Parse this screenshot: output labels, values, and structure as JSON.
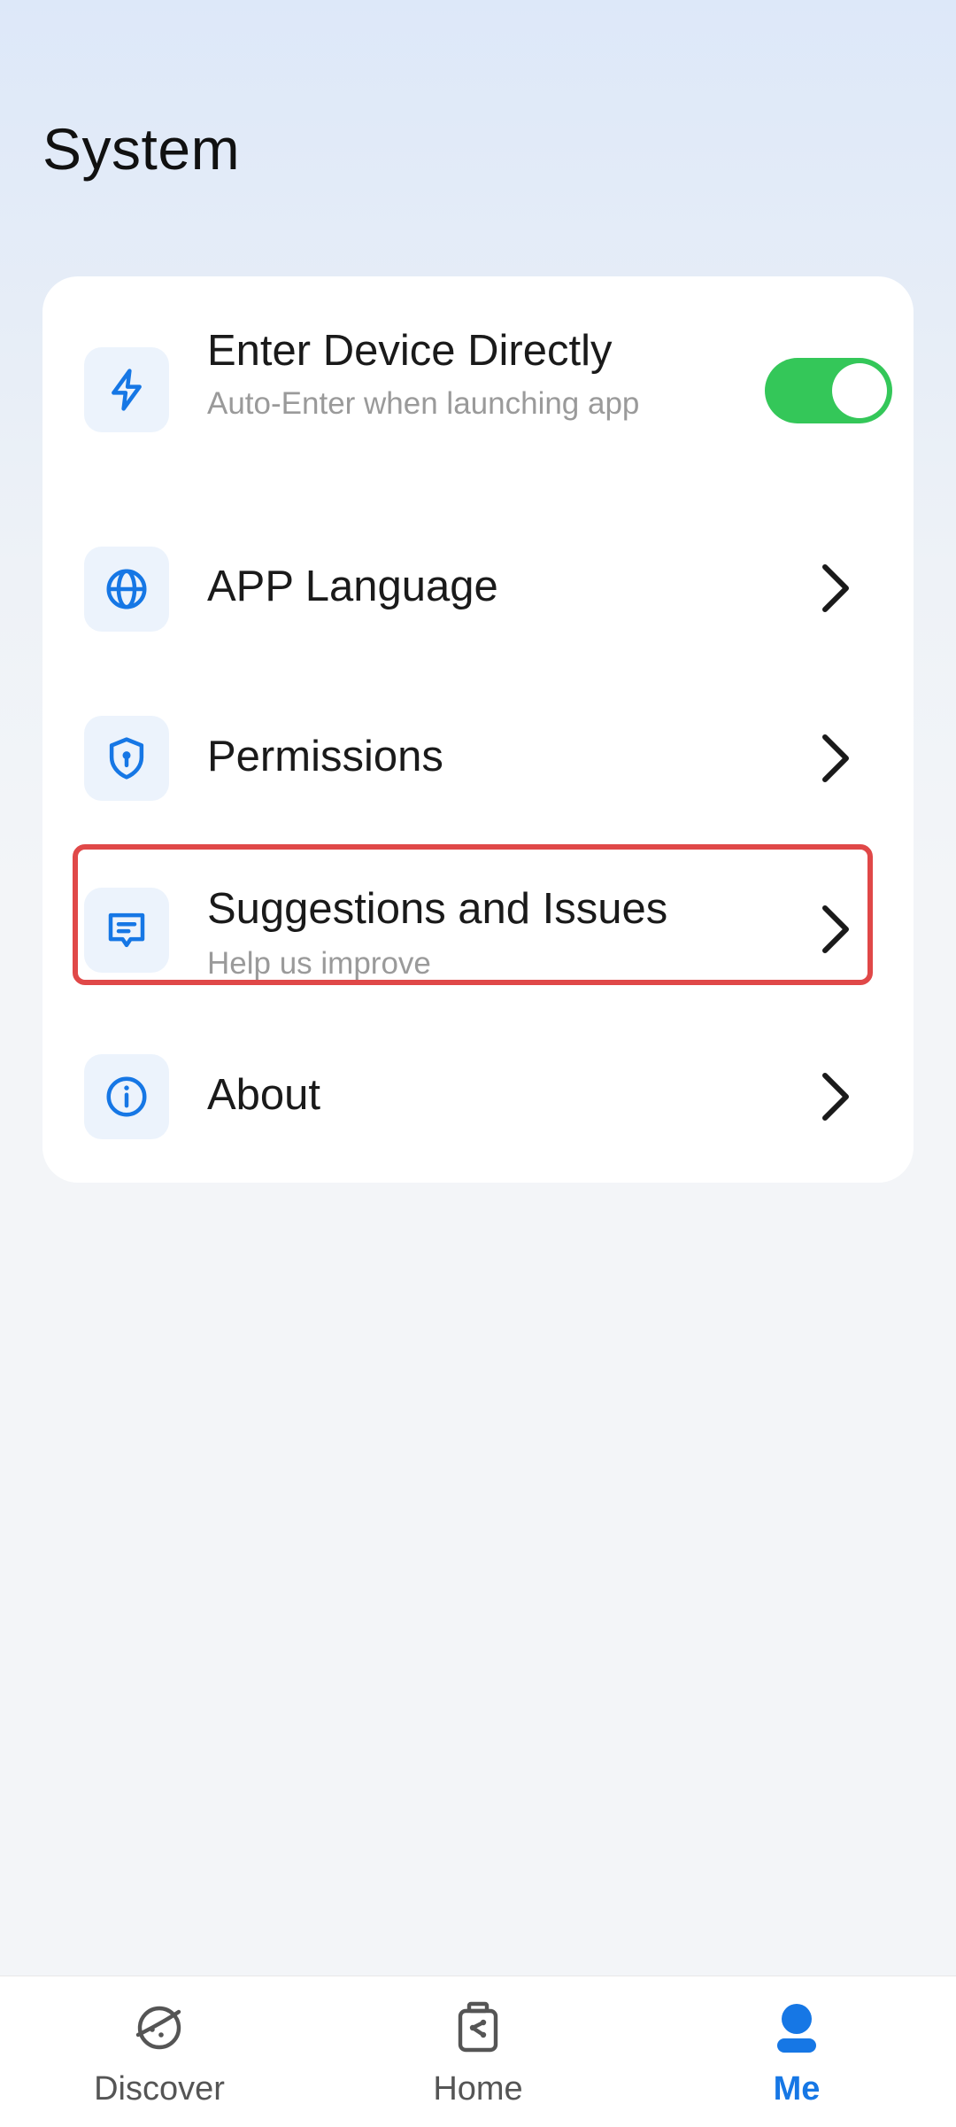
{
  "page": {
    "title": "System"
  },
  "settings": {
    "items": [
      {
        "label": "Enter Device Directly",
        "sublabel": "Auto-Enter when launching app",
        "icon": "lightning-icon",
        "toggle_on": true
      },
      {
        "label": "APP Language",
        "icon": "globe-icon"
      },
      {
        "label": "Permissions",
        "icon": "shield-icon"
      },
      {
        "label": "Suggestions and Issues",
        "sublabel": "Help us improve",
        "icon": "feedback-message-icon"
      },
      {
        "label": "About",
        "icon": "info-icon"
      }
    ]
  },
  "tabbar": {
    "tabs": [
      {
        "label": "Discover",
        "icon": "discover-planet-icon"
      },
      {
        "label": "Home",
        "icon": "home-device-icon"
      },
      {
        "label": "Me",
        "icon": "user-icon",
        "active": true
      }
    ]
  },
  "colors": {
    "accent": "#1677e5",
    "toggle_on": "#34c759",
    "highlight": "#e04848"
  }
}
